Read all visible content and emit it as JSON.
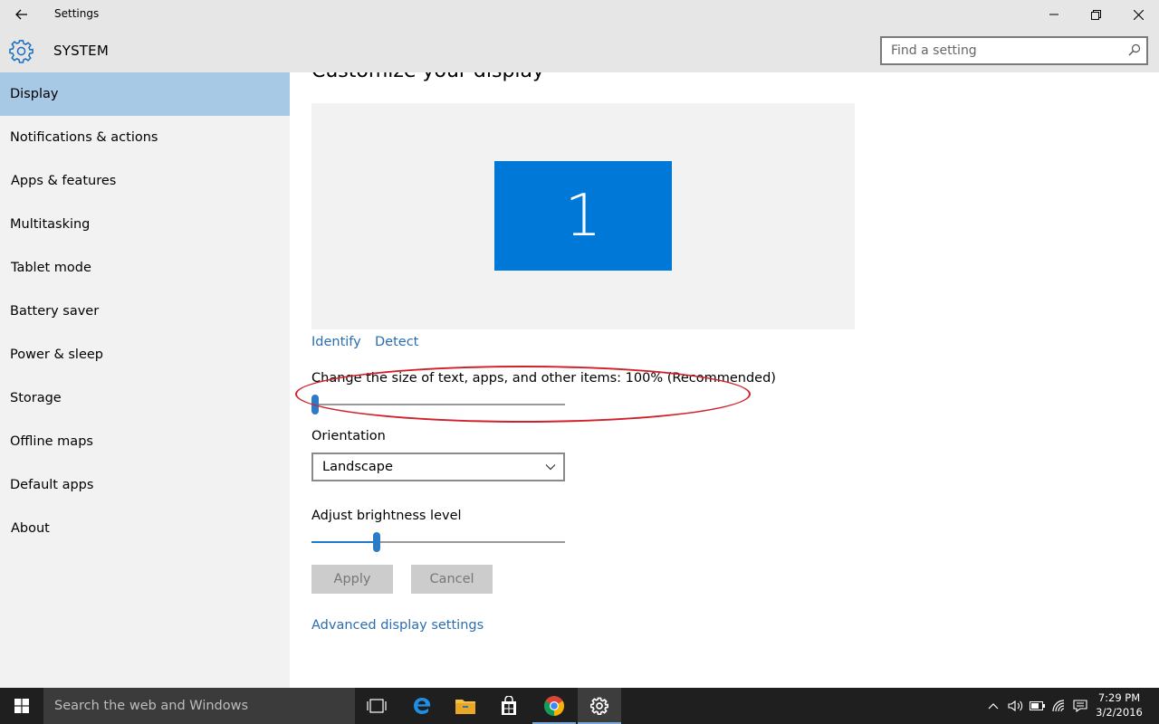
{
  "window": {
    "title": "Settings"
  },
  "header": {
    "section": "SYSTEM",
    "search_placeholder": "Find a setting"
  },
  "sidebar": {
    "items": [
      {
        "label": "Display",
        "active": true
      },
      {
        "label": "Notifications & actions"
      },
      {
        "label": "Apps & features"
      },
      {
        "label": "Multitasking"
      },
      {
        "label": "Tablet mode"
      },
      {
        "label": "Battery saver"
      },
      {
        "label": "Power & sleep"
      },
      {
        "label": "Storage"
      },
      {
        "label": "Offline maps"
      },
      {
        "label": "Default apps"
      },
      {
        "label": "About"
      }
    ]
  },
  "main": {
    "title": "Customize your display",
    "monitor_number": "1",
    "identify_link": "Identify",
    "detect_link": "Detect",
    "scale_label": "Change the size of text, apps, and other items: 100% (Recommended)",
    "scale_level": 0,
    "orientation_label": "Orientation",
    "orientation_value": "Landscape",
    "brightness_label": "Adjust brightness level",
    "brightness_level": 0.25,
    "apply_button": "Apply",
    "cancel_button": "Cancel",
    "advanced_link": "Advanced display settings"
  },
  "taskbar": {
    "search_placeholder": "Search the web and Windows",
    "time": "7:29 PM",
    "date": "3/2/2016"
  },
  "colors": {
    "accent": "#0078d7",
    "sidebar_active": "#a8c9e6",
    "link": "#2a6db0",
    "highlight_annotation": "#d0202a"
  }
}
